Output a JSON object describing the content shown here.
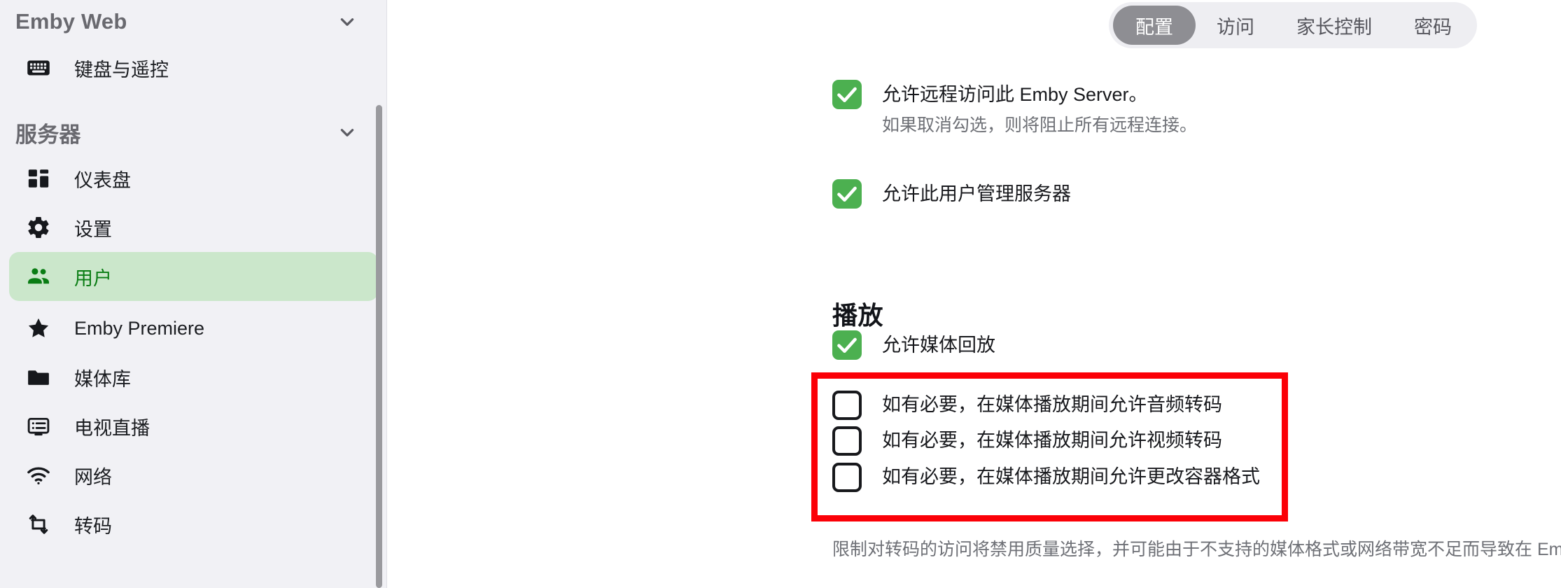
{
  "sidebar": {
    "sections": [
      {
        "title": "Emby Web",
        "chevron_icon": "chevron-down-icon",
        "items": [
          {
            "label": "键盘与遥控",
            "icon": "keyboard-icon",
            "active": false
          }
        ]
      },
      {
        "title": "服务器",
        "chevron_icon": "chevron-down-icon",
        "items": [
          {
            "label": "仪表盘",
            "icon": "dashboard-icon",
            "active": false
          },
          {
            "label": "设置",
            "icon": "gear-icon",
            "active": false
          },
          {
            "label": "用户",
            "icon": "users-icon",
            "active": true
          },
          {
            "label": "Emby Premiere",
            "icon": "star-icon",
            "active": false
          },
          {
            "label": "媒体库",
            "icon": "folder-icon",
            "active": false
          },
          {
            "label": "电视直播",
            "icon": "livetv-icon",
            "active": false
          },
          {
            "label": "网络",
            "icon": "wifi-icon",
            "active": false
          },
          {
            "label": "转码",
            "icon": "transcode-icon",
            "active": false
          }
        ]
      }
    ],
    "scrollbar": "vertical-scrollbar"
  },
  "tabs": [
    {
      "label": "配置",
      "selected": true
    },
    {
      "label": "访问",
      "selected": false
    },
    {
      "label": "家长控制",
      "selected": false
    },
    {
      "label": "密码",
      "selected": false
    }
  ],
  "main": {
    "remote_access": {
      "label": "允许远程访问此 Emby Server。",
      "checked": true,
      "description": "如果取消勾选，则将阻止所有远程连接。"
    },
    "manage_server": {
      "label": "允许此用户管理服务器",
      "checked": true
    },
    "playback_section": {
      "title": "播放",
      "allow_playback": {
        "label": "允许媒体回放",
        "checked": true
      },
      "highlighted_options": [
        {
          "label": "如有必要，在媒体播放期间允许音频转码",
          "checked": false
        },
        {
          "label": "如有必要，在媒体播放期间允许视频转码",
          "checked": false
        },
        {
          "label": "如有必要，在媒体播放期间允许更改容器格式",
          "checked": false
        }
      ],
      "footnote": "限制对转码的访问将禁用质量选择，并可能由于不支持的媒体格式或网络带宽不足而导致在 Emby 应用程序中的播放失败。"
    }
  },
  "colors": {
    "accent_green": "#4cb050",
    "active_item_bg": "#cbe7cb",
    "active_item_text": "#0a7d14",
    "highlight_red": "#fb0007",
    "sidebar_bg": "#f1f1f5",
    "tab_selected_bg": "#8e8e93"
  }
}
